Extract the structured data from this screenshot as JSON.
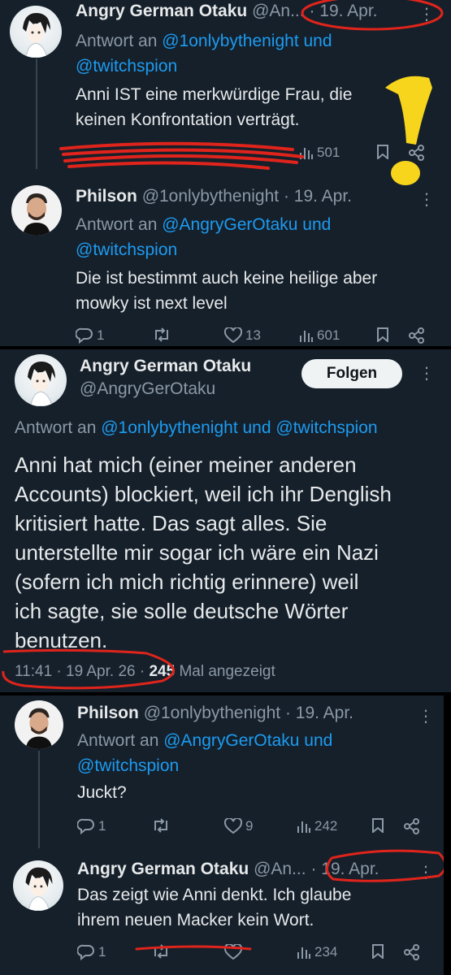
{
  "tweet1": {
    "name": "Angry German Otaku",
    "handle": "@An...",
    "date": "· 19. Apr.",
    "reply_prefix": "Antwort an ",
    "reply_users": "@1onlybythenight und",
    "reply_users2": "@twitchspion",
    "text_line1": "Anni IST eine merkwürdige Frau, die",
    "text_line2": "keinen Konfrontation verträgt.",
    "views": "501"
  },
  "tweet2": {
    "name": "Philson",
    "handle": "@1onlybythenight · 19. Apr.",
    "reply_prefix": "Antwort an ",
    "reply_users": "@AngryGerOtaku und",
    "reply_users2": "@twitchspion",
    "text_line1": "Die ist bestimmt auch keine heilige aber",
    "text_line2": "mowky ist next level",
    "replies": "1",
    "likes": "13",
    "views": "601"
  },
  "tweet3": {
    "name": "Angry German Otaku",
    "handle": "@AngryGerOtaku",
    "follow_label": "Folgen",
    "reply_prefix": "Antwort an ",
    "reply_users": "@1onlybythenight und @twitchspion",
    "lines": [
      "Anni hat mich (einer meiner anderen",
      "Accounts) blockiert, weil ich ihr Denglish",
      "kritisiert hatte. Das sagt alles. Sie",
      "unterstellte mir sogar ich wäre ein Nazi",
      "(sofern ich mich richtig erinnere) weil",
      "ich sagte, sie solle deutsche Wörter",
      "benutzen."
    ],
    "timestamp": "11:41 · 19 Apr. 26 · ",
    "view_count": "245",
    "view_suffix": " Mal angezeigt"
  },
  "tweet4": {
    "name": "Philson",
    "handle": "@1onlybythenight · 19. Apr.",
    "reply_prefix": "Antwort an ",
    "reply_users": "@AngryGerOtaku und",
    "reply_users2": "@twitchspion",
    "text": "Juckt?",
    "replies": "1",
    "likes": "9",
    "views": "242"
  },
  "tweet5": {
    "name": "Angry German Otaku",
    "handle": "@An...",
    "date": "· 19. Apr.",
    "text_line1": "Das zeigt wie Anni denkt. Ich glaube",
    "text_line2": "ihrem neuen Macker kein Wort.",
    "replies": "1",
    "views": "234"
  },
  "colors": {
    "background": "#15202b",
    "link": "#1d9bf0",
    "secondary_text": "#8b98a5",
    "annotation_red": "#e0241b",
    "annotation_yellow": "#f7d51d"
  }
}
